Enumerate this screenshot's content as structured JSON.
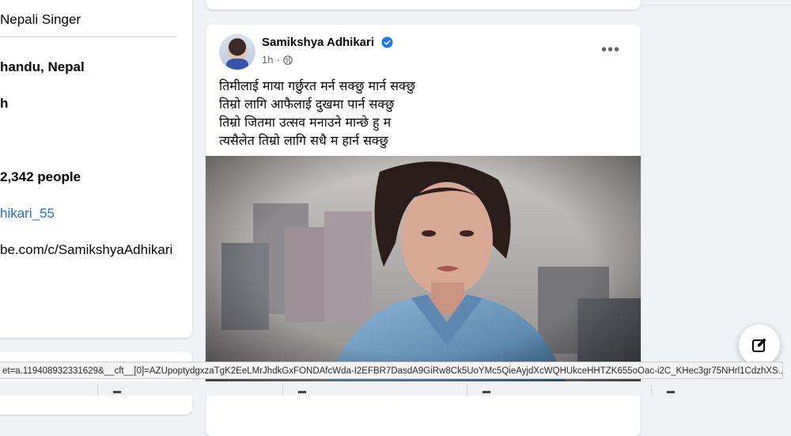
{
  "intro": {
    "category": "Nepali Singer",
    "location": "handu, Nepal",
    "item3": "h",
    "followers": "2,342 people",
    "instagram": "hikari_55",
    "youtube": "be.com/c/SamikshyaAdhikari"
  },
  "post": {
    "author": "Samikshya Adhikari",
    "time": "1h",
    "more_label": "•••",
    "lines": [
      "तिमीलाई माया गर्छुरत मर्न सक्छु मार्न सक्छु",
      "तिम्रो लागि आफैलाई  दुखमा पार्न सक्छु",
      "तिम्रो जितमा उत्सव मनाउने मान्छे हु म",
      "त्यसैलेत तिम्रो लागि सधै म हार्न सक्छु"
    ]
  },
  "status_bar": {
    "url": "et=a.119408932331629&__cft__[0]=AZUpoptydgxzaTgK2EeLMrJhdkGxFONDAfcWda-I2EFBR7DasdA9GiRw8Ck5UoYMc5QieAyjdXcWQHUkceHHTZK655oOac-i2C_KHec3gr75NHrl1CdzhXS..."
  },
  "colors": {
    "link": "#216fdb",
    "verified": "#1877f2",
    "background": "#f0f2f5"
  }
}
